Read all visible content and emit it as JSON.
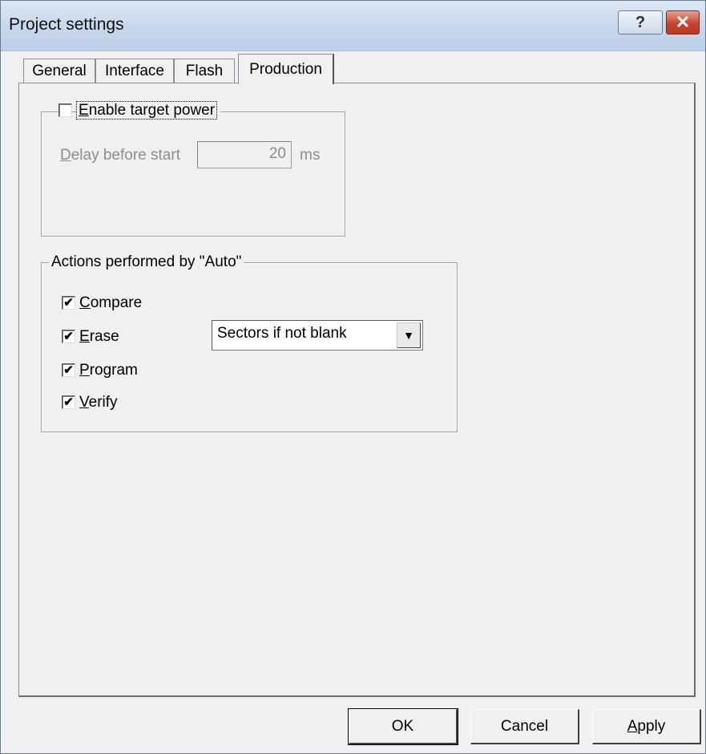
{
  "window": {
    "title": "Project settings",
    "help_glyph": "?",
    "close_glyph": "✕"
  },
  "tabs": [
    {
      "label": "General"
    },
    {
      "label": "Interface"
    },
    {
      "label": "Flash"
    },
    {
      "label": "Production"
    }
  ],
  "active_tab": "Production",
  "target_power": {
    "checkbox_label_prefix": "",
    "checkbox_label_mnemonic": "E",
    "checkbox_label_rest": "nable target power",
    "checked": false,
    "delay_label_mnemonic": "D",
    "delay_label_rest": "elay before start",
    "delay_value": "20",
    "delay_unit": "ms"
  },
  "auto_actions": {
    "legend": "Actions performed by \"Auto\"",
    "items": [
      {
        "mnemonic": "C",
        "rest": "ompare",
        "checked": true,
        "mark": "✔"
      },
      {
        "mnemonic": "E",
        "rest": "rase",
        "checked": true,
        "mark": "✔"
      },
      {
        "mnemonic": "P",
        "rest": "rogram",
        "checked": true,
        "mark": "✔"
      },
      {
        "mnemonic": "V",
        "rest": "erify",
        "checked": true,
        "mark": "✔"
      }
    ],
    "erase_mode": "Sectors if not blank",
    "dropdown_arrow": "▼"
  },
  "buttons": {
    "ok": "OK",
    "cancel": "Cancel",
    "apply_mnemonic": "A",
    "apply_rest": "pply"
  }
}
